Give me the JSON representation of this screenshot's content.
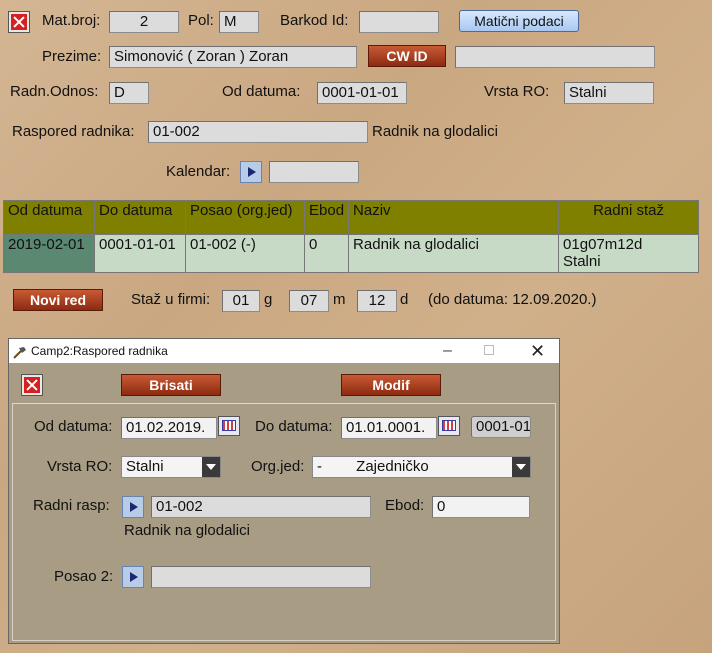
{
  "header": {
    "mat_broj_label": "Mat.broj:",
    "mat_broj_value": "2",
    "pol_label": "Pol:",
    "pol_value": "M",
    "barkod_label": "Barkod Id:",
    "barkod_value": "",
    "maticni_button": "Matični podaci",
    "prezime_label": "Prezime:",
    "prezime_value": "Simonović ( Zoran ) Zoran",
    "cwid_button": "CW ID",
    "cwid_value": "",
    "radn_odnos_label": "Radn.Odnos:",
    "radn_odnos_value": "D",
    "od_datuma_label": "Od datuma:",
    "od_datuma_value": "0001-01-01",
    "vrsta_ro_label": "Vrsta RO:",
    "vrsta_ro_value": "Stalni",
    "raspored_label": "Raspored radnika:",
    "raspored_value": "01-002",
    "raspored_desc": "Radnik na glodalici",
    "kalendar_label": "Kalendar:",
    "kalendar_value": ""
  },
  "table": {
    "columns": [
      "Od datuma",
      "Do datuma",
      "Posao (org.jed)",
      "Ebod",
      "Naziv",
      "Radni staž"
    ],
    "rows": [
      {
        "od": "2019-02-01",
        "do": "0001-01-01",
        "posao": "01-002 (-)",
        "ebod": "0",
        "naziv": "Radnik na glodalici",
        "staz_line1": "01g07m12d",
        "staz_line2": "Stalni"
      }
    ]
  },
  "footer": {
    "novi_red_button": "Novi red",
    "staz_label": "Staž u firmi:",
    "godine": "01",
    "g_unit": "g",
    "meseci": "07",
    "m_unit": "m",
    "dani": "12",
    "d_unit": "d",
    "do_datuma_note": "(do datuma: 12.09.2020.)"
  },
  "dialog": {
    "title": "Camp2:Raspored radnika",
    "brisati_button": "Brisati",
    "modif_button": "Modif",
    "od_datuma_label": "Od datuma:",
    "od_datuma_value": "01.02.2019.",
    "do_datuma_label": "Do datuma:",
    "do_datuma_value": "01.01.0001.",
    "do_datuma_extra": "0001-01",
    "vrsta_ro_label": "Vrsta RO:",
    "vrsta_ro_value": "Stalni",
    "org_jed_label": "Org.jed:",
    "org_jed_code": "-",
    "org_jed_value": "Zajedničko",
    "radni_rasp_label": "Radni rasp:",
    "radni_rasp_value": "01-002",
    "radni_rasp_desc": "Radnik na glodalici",
    "ebod_label": "Ebod:",
    "ebod_value": "0",
    "posao2_label": "Posao 2:",
    "posao2_value": ""
  }
}
